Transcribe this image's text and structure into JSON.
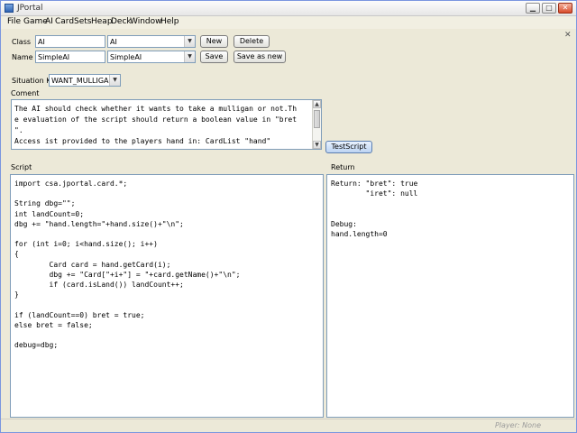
{
  "window": {
    "title": "JPortal"
  },
  "menu": [
    "File",
    "Game",
    "AI",
    "Card",
    "Sets",
    "Heap",
    "Deck",
    "Window",
    "Help"
  ],
  "form": {
    "class_label": "Class",
    "class_value": "AI",
    "class_select": "AI",
    "name_label": "Name",
    "name_value": "SimpleAI",
    "name_select": "SimpleAI",
    "new_button": "New",
    "delete_button": "Delete",
    "save_button": "Save",
    "save_as_new_button": "Save as new",
    "situation_key_label": "Situation Key",
    "situation_key_value": "WANT_MULLIGAN",
    "comment_label": "Coment",
    "comment_lines": [
      "The AI should check whether it wants to take a mulligan or not.Th",
      "e evaluation of the script should return a boolean value in \"bret",
      "\".",
      "Access ist provided to the players hand in: CardList \"hand\""
    ],
    "test_script_button": "TestScript"
  },
  "script": {
    "label": "Script",
    "lines": [
      "import csa.jportal.card.*;",
      "",
      "String dbg=\"\";",
      "int landCount=0;",
      "dbg += \"hand.length=\"+hand.size()+\"\\n\";",
      "",
      "for (int i=0; i<hand.size(); i++)",
      "{",
      "        Card card = hand.getCard(i);",
      "        dbg += \"Card[\"+i+\"] = \"+card.getName()+\"\\n\";",
      "        if (card.isLand()) landCount++;",
      "}",
      "",
      "if (landCount==0) bret = true;",
      "else bret = false;",
      "",
      "debug=dbg;"
    ]
  },
  "result": {
    "label": "Return",
    "lines": [
      "Return: \"bret\": true",
      "        \"iret\": null",
      "",
      "",
      "Debug:",
      "hand.length=0"
    ]
  },
  "status": {
    "player": "Player: None"
  },
  "colors": {
    "accent": "#5a7db0",
    "window_bg": "#ece9d8",
    "field_border": "#7f9db9"
  },
  "icons": {
    "app": "app-icon",
    "minimize": "minimize-icon",
    "maximize": "maximize-icon",
    "close": "close-icon",
    "dropdown": "chevron-down-icon"
  }
}
